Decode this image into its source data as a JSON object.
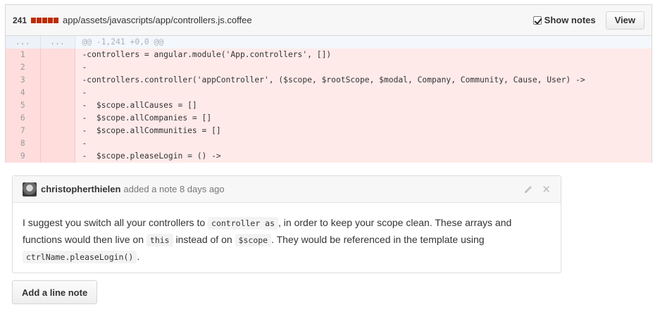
{
  "file": {
    "diffstat_count": "241",
    "path": "app/assets/javascripts/app/controllers.js.coffee",
    "show_notes_label": "Show notes",
    "show_notes_checked": true,
    "view_button": "View"
  },
  "diff": {
    "hunk": {
      "old": "...",
      "new": "...",
      "text": "@@ -1,241 +0,0 @@"
    },
    "lines": [
      {
        "old": "1",
        "new": "",
        "text": "-controllers = angular.module('App.controllers', [])"
      },
      {
        "old": "2",
        "new": "",
        "text": "-"
      },
      {
        "old": "3",
        "new": "",
        "text": "-controllers.controller('appController', ($scope, $rootScope, $modal, Company, Community, Cause, User) ->"
      },
      {
        "old": "4",
        "new": "",
        "text": "-"
      },
      {
        "old": "5",
        "new": "",
        "text": "-  $scope.allCauses = []"
      },
      {
        "old": "6",
        "new": "",
        "text": "-  $scope.allCompanies = []"
      },
      {
        "old": "7",
        "new": "",
        "text": "-  $scope.allCommunities = []"
      },
      {
        "old": "8",
        "new": "",
        "text": "-"
      },
      {
        "old": "9",
        "new": "",
        "text": "-  $scope.pleaseLogin = () ->"
      }
    ]
  },
  "comment": {
    "author": "christopherthielen",
    "meta": "added a note 8 days ago",
    "body": {
      "t1": "I suggest you switch all your controllers to ",
      "c1": "controller as",
      "t2": ", in order to keep your scope clean. These arrays and functions would then live on ",
      "c2": "this",
      "t3": " instead of on ",
      "c3": "$scope",
      "t4": ". They would be referenced in the template using ",
      "c4": "ctrlName.pleaseLogin()",
      "t5": "."
    }
  },
  "add_note_button": "Add a line note",
  "colors": {
    "deletion_bg": "#ffeaea",
    "deletion_num_bg": "#ffdddd",
    "diffstat_red": "#bd2c00"
  }
}
